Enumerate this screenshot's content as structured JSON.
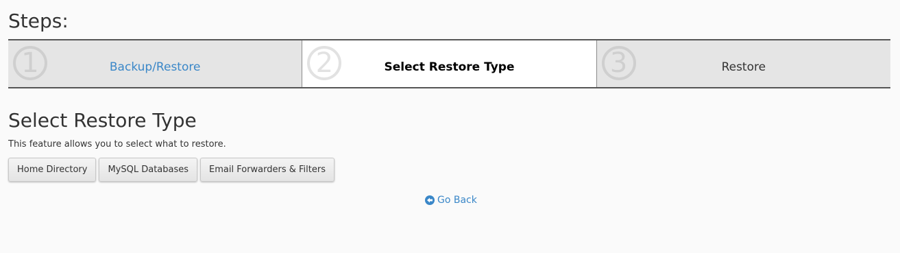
{
  "steps_heading": "Steps:",
  "steps": [
    {
      "number": "1",
      "label": "Backup/Restore",
      "state": "link"
    },
    {
      "number": "2",
      "label": "Select Restore Type",
      "state": "current"
    },
    {
      "number": "3",
      "label": "Restore",
      "state": "upcoming"
    }
  ],
  "section": {
    "title": "Select Restore Type",
    "description": "This feature allows you to select what to restore."
  },
  "buttons": {
    "home_directory": "Home Directory",
    "mysql_databases": "MySQL Databases",
    "email_forwarders": "Email Forwarders & Filters"
  },
  "go_back": {
    "label": "Go Back",
    "icon": "arrow-circle-left-icon"
  },
  "colors": {
    "link": "#3a87c8",
    "step_bg": "#e5e5e5",
    "step_active_bg": "#ffffff",
    "page_bg": "#fafafa"
  }
}
